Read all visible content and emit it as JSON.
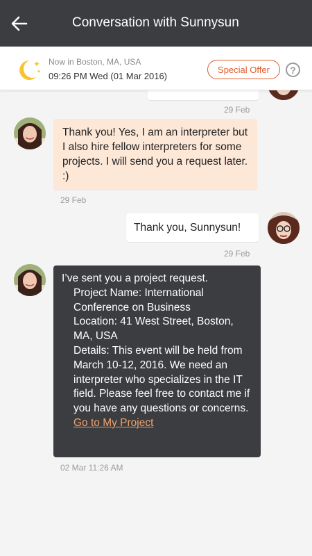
{
  "header": {
    "title": "Conversation with Sunnysun"
  },
  "info": {
    "location": "Now in Boston, MA, USA",
    "datetime": "09:26 PM Wed (01 Mar 2016)",
    "special_offer": "Special Offer",
    "help": "?"
  },
  "messages": [
    {
      "time": "29 Feb"
    },
    {
      "text": "Thank you! Yes, I am an interpreter but I also hire fellow interpreters for some projects. I will send you a request later. :)",
      "time": "29 Feb"
    },
    {
      "text": "Thank you, Sunnysun!",
      "time": "29 Feb"
    },
    {
      "intro": "I’ve sent you a project request.",
      "project_name": "Project Name: International Conference on Business",
      "location": "Location: 41 West Street, Boston, MA, USA",
      "details": "Details: This event will be held from March 10-12, 2016. We need an interpreter who specializes in the IT field. Please feel free to contact me if you have any questions or concerns.",
      "link": "Go to My Project",
      "time": "02 Mar 11:26 AM"
    }
  ],
  "colors": {
    "appbar": "#3c3d41",
    "accent": "#e05a2b",
    "incoming_bubble": "#fde7d7",
    "request_bubble": "#3c3d41",
    "link": "#f0a36d"
  }
}
